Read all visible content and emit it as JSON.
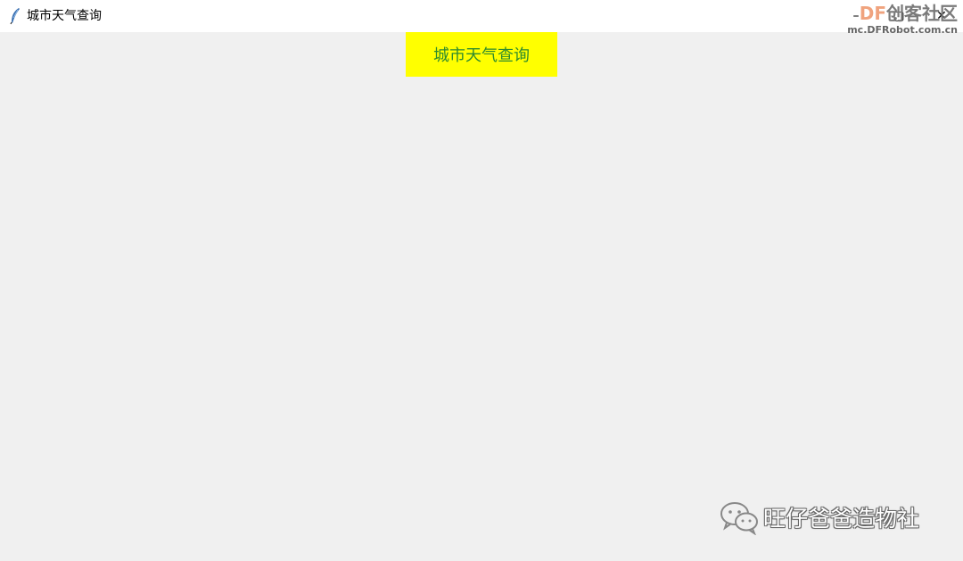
{
  "window": {
    "title": "城市天气查询",
    "icon": "feather-icon",
    "controls": {
      "minimize": "–",
      "maximize": "▢",
      "close": "✕"
    }
  },
  "main": {
    "header_label": "城市天气查询",
    "header_bg": "#ffff00",
    "header_fg": "#2e8b2e"
  },
  "watermarks": {
    "brand_df": "DF",
    "brand_cn": "创客社区",
    "url": "mc.DFRobot.com.cn",
    "account": "旺仔爸爸造物社",
    "account_icon": "wechat-icon"
  }
}
